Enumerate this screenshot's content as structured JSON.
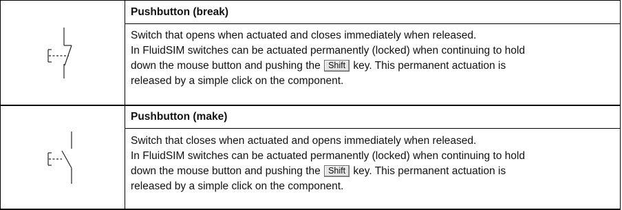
{
  "rows": [
    {
      "symbol": "pushbutton-break-symbol",
      "title": "Pushbutton (break)",
      "line1": "Switch that opens when actuated and closes immediately when released.",
      "line2": "In FluidSIM switches can be actuated permanently (locked) when continuing to hold",
      "line3_before": "down the mouse button and pushing the",
      "key": "Shift",
      "line3_after": "key. This permanent actuation is",
      "line4": "released by a simple click on the component."
    },
    {
      "symbol": "pushbutton-make-symbol",
      "title": "Pushbutton (make)",
      "line1": "Switch that closes when actuated and opens immediately when released.",
      "line2": "In FluidSIM switches can be actuated permanently (locked) when continuing to hold",
      "line3_before": "down the mouse button and pushing the",
      "key": "Shift",
      "line3_after": "key. This permanent actuation is",
      "line4": "released by a simple click on the component."
    }
  ]
}
